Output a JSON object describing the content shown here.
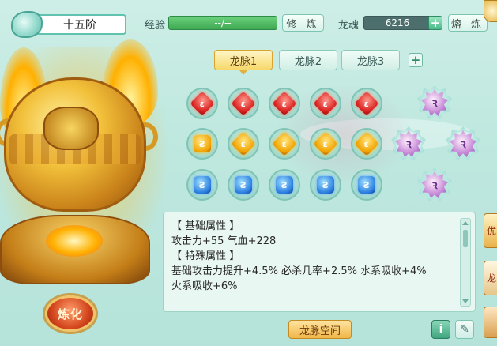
{
  "header": {
    "rank": "十五阶",
    "exp_label": "经验",
    "exp_value": "--/--",
    "cultivate_button": "修 炼",
    "soul_label": "龙魂",
    "soul_value": "6216",
    "smelt_button": "熔 炼"
  },
  "tabs": [
    {
      "label": "龙脉1",
      "active": true
    },
    {
      "label": "龙脉2",
      "active": false
    },
    {
      "label": "龙脉3",
      "active": false
    }
  ],
  "gem_rows": [
    {
      "color": "red",
      "count": 5
    },
    {
      "color": "gold",
      "count": 5
    },
    {
      "color": "blue",
      "count": 5
    }
  ],
  "special_gems": [
    "dragon-gem-top",
    "dragon-gem-left",
    "dragon-gem-right",
    "dragon-gem-bottom"
  ],
  "attributes": {
    "base_title": "【 基础属性 】",
    "base_line": "攻击力+55  气血+228",
    "special_title": "【 特殊属性 】",
    "special_line1": "基础攻击力提升+4.5%  必杀几率+2.5%  水系吸收+4%",
    "special_line2": "火系吸收+6%"
  },
  "refine_button": "炼化",
  "space_button": "龙脉空间",
  "side_tabs": [
    "优",
    "龙"
  ],
  "icons": {
    "info": "info-icon",
    "edit": "edit-icon"
  }
}
